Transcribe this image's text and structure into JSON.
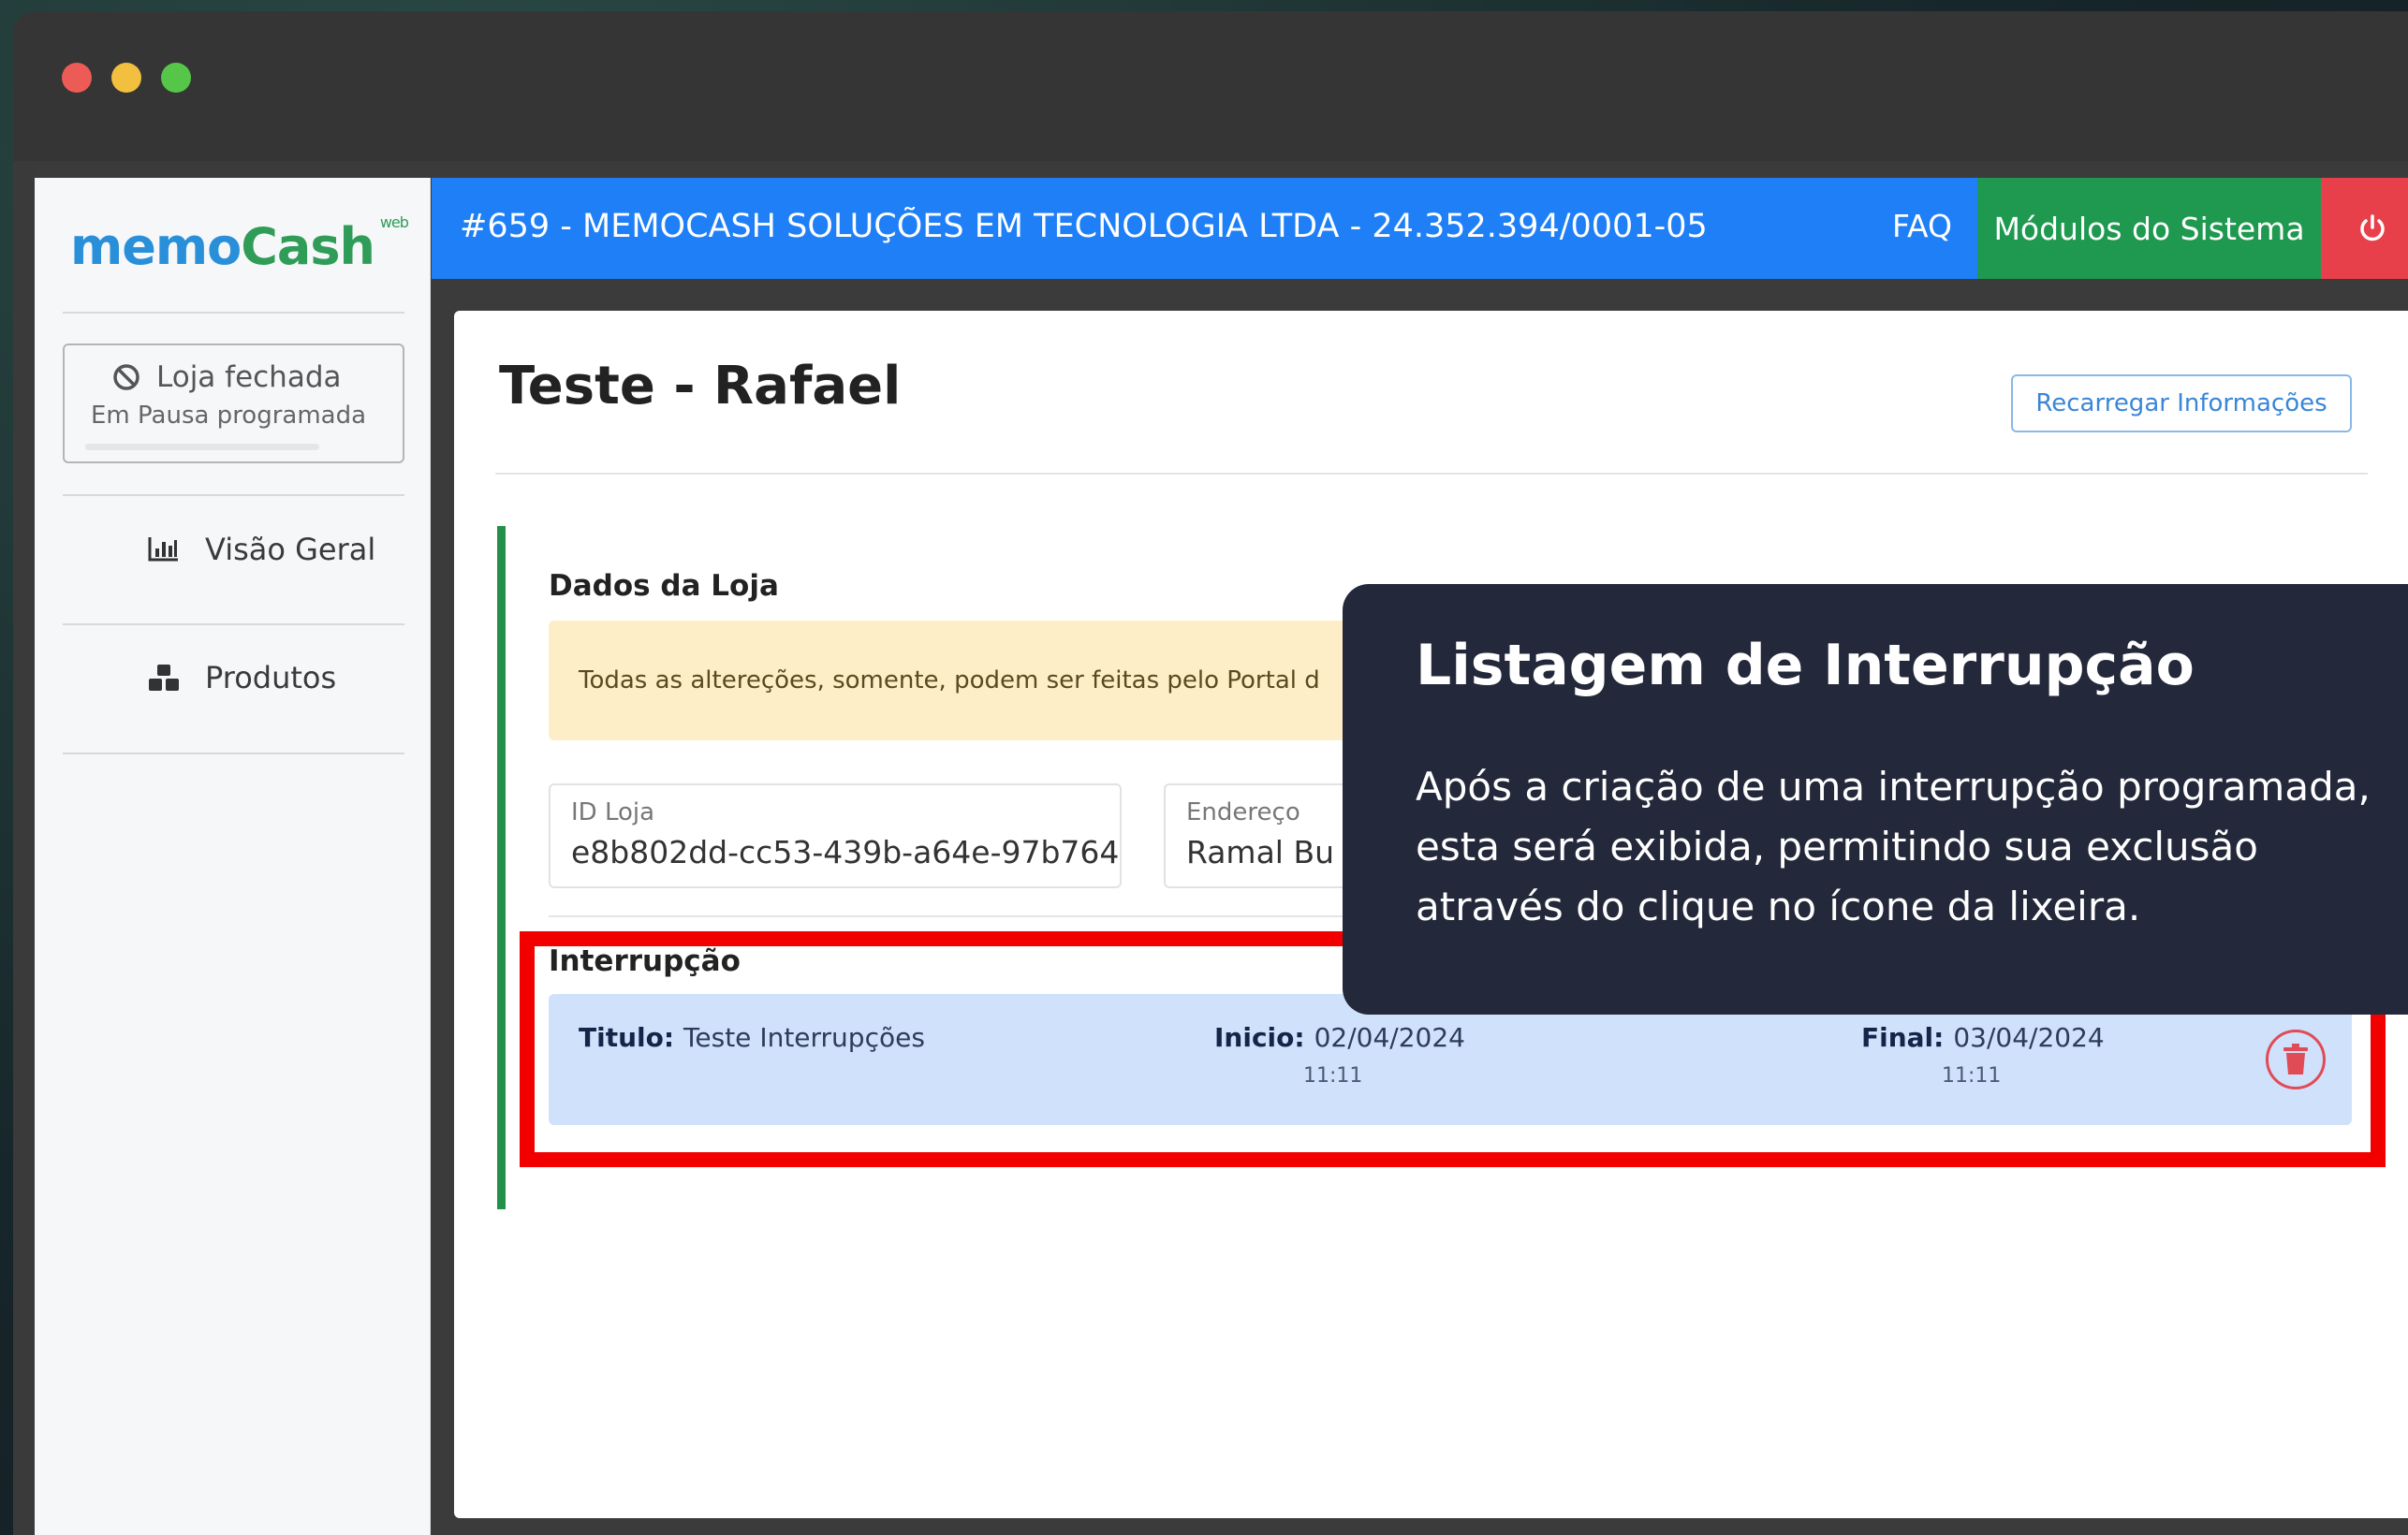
{
  "app": {
    "logo_main": "memo",
    "logo_accent": "Cash",
    "logo_suffix": "web"
  },
  "sidebar": {
    "status_title": "Loja fechada",
    "status_subtitle": "Em Pausa programada",
    "items": [
      {
        "label": "Visão Geral",
        "icon": "bar-chart-icon"
      },
      {
        "label": "Produtos",
        "icon": "boxes-icon"
      }
    ]
  },
  "header": {
    "company": "#659 - MEMOCASH SOLUÇÕES EM TECNOLOGIA LTDA - 24.352.394/0001-05",
    "faq": "FAQ",
    "modules": "Módulos do Sistema",
    "colors": {
      "bar": "#1f7ff7",
      "modules": "#1f9950",
      "power": "#e8404b"
    }
  },
  "main": {
    "page_title": "Teste - Rafael",
    "reload_button": "Recarregar Informações",
    "store_section_title": "Dados da Loja",
    "notice": "Todas as altereções, somente, podem ser feitas pelo Portal d",
    "fields": [
      {
        "label": "ID Loja",
        "value": "e8b802dd-cc53-439b-a64e-97b764"
      },
      {
        "label": "Endereço",
        "value": "Ramal Bu"
      }
    ],
    "interruption": {
      "section_title": "Interrupção",
      "title_label": "Titulo:",
      "title_value": "Teste Interrupções",
      "start_label": "Inicio:",
      "start_date": "02/04/2024",
      "start_time": "11:11",
      "end_label": "Final:",
      "end_date": "03/04/2024",
      "end_time": "11:11"
    }
  },
  "tooltip": {
    "title": "Listagem de Interrupção",
    "body": "Após a criação de uma interrupção programada, esta será exibida, permitindo sua exclusão através do clique no ícone da lixeira."
  }
}
